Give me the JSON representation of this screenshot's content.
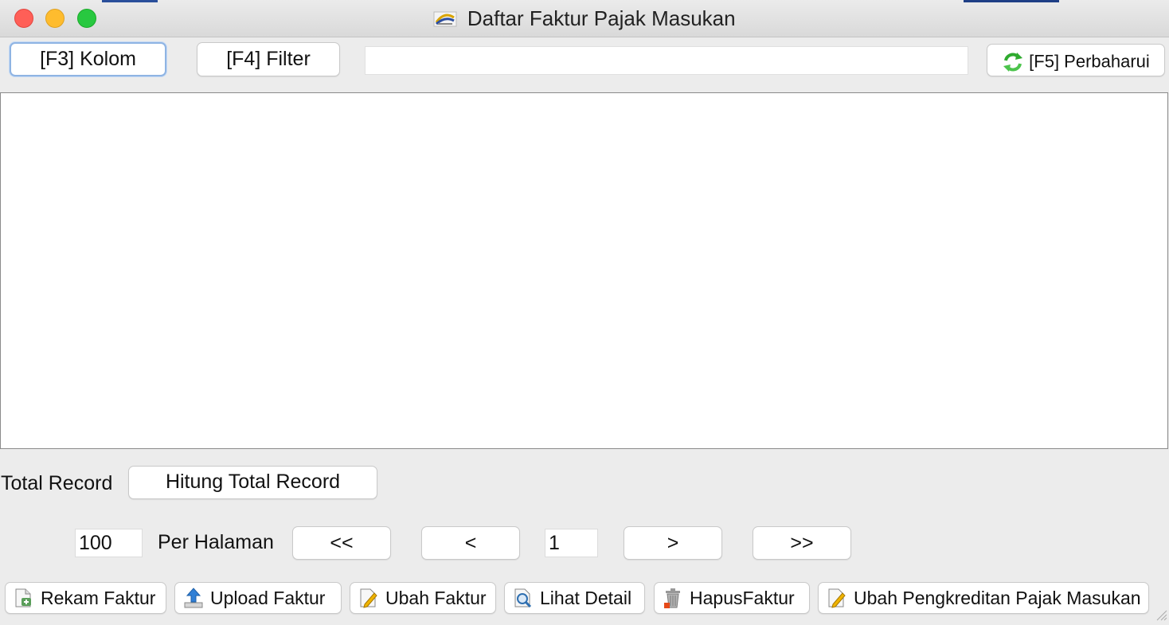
{
  "window": {
    "title": "Daftar Faktur Pajak Masukan",
    "icon": "app-logo-icon"
  },
  "toolbar": {
    "kolom_label": "[F3] Kolom",
    "filter_label": "[F4] Filter",
    "search_value": "",
    "refresh_label": "[F5] Perbaharui",
    "refresh_icon": "refresh-icon"
  },
  "footer": {
    "total_record_label": "Total Record",
    "hitung_label": "Hitung Total Record",
    "page_size_value": "100",
    "per_halaman_label": "Per Halaman",
    "first_label": "<<",
    "prev_label": "<",
    "page_value": "1",
    "next_label": ">",
    "last_label": ">>"
  },
  "actions": [
    {
      "label": "Rekam Faktur",
      "icon": "add-document-icon"
    },
    {
      "label": "Upload Faktur",
      "icon": "upload-icon"
    },
    {
      "label": "Ubah Faktur",
      "icon": "edit-document-icon"
    },
    {
      "label": "Lihat Detail",
      "icon": "view-detail-icon"
    },
    {
      "label": "HapusFaktur",
      "icon": "trash-icon"
    },
    {
      "label": "Ubah Pengkreditan Pajak Masukan",
      "icon": "edit-document-icon"
    }
  ],
  "colors": {
    "close": "#ff5f57",
    "minimize": "#febc2e",
    "maximize": "#28c840",
    "focus_ring": "#8fb4e3",
    "refresh_green": "#2eaa2e"
  }
}
